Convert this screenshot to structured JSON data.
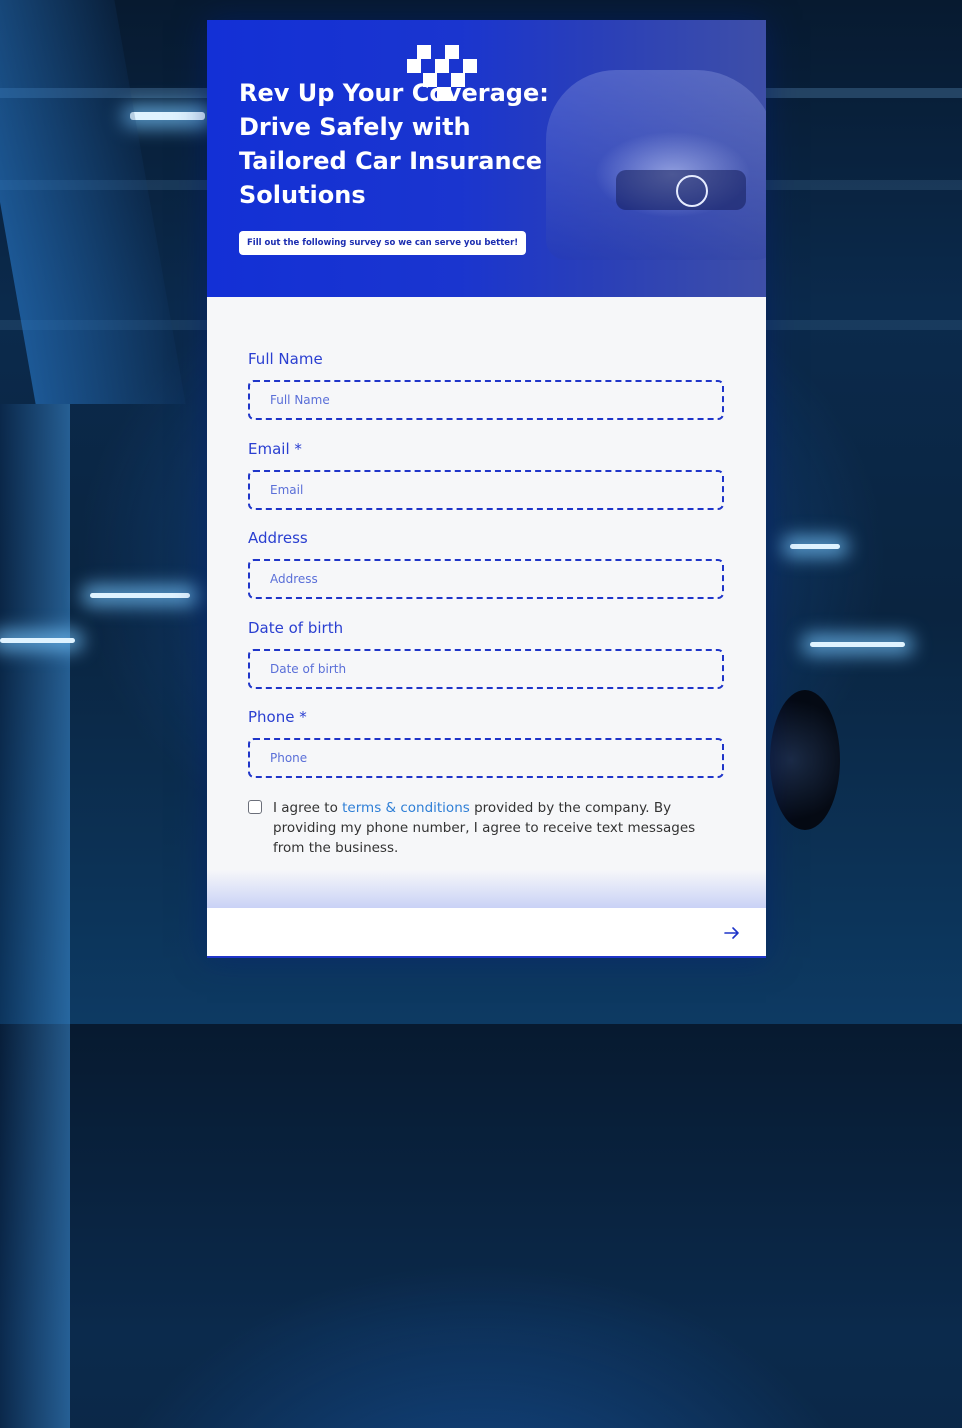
{
  "hero": {
    "title": "Rev Up Your Coverage: Drive Safely with Tailored Car Insurance Solutions",
    "subtitle": "Fill out the following survey so we can serve you better!"
  },
  "form": {
    "fields": [
      {
        "label": "Full Name",
        "placeholder": "Full Name"
      },
      {
        "label": "Email *",
        "placeholder": "Email"
      },
      {
        "label": "Address",
        "placeholder": "Address"
      },
      {
        "label": "Date of birth",
        "placeholder": "Date of birth"
      },
      {
        "label": "Phone *",
        "placeholder": "Phone"
      }
    ],
    "consent": {
      "prefix": "I agree to ",
      "link": "terms & conditions",
      "suffix": " provided by the company. By providing my phone number, I agree to receive text messages from the business.",
      "checked": false
    }
  },
  "footer": {
    "next_icon": "arrow-right-icon"
  },
  "colors": {
    "accent": "#1f35c9",
    "hero_bg": "#1330d6",
    "link": "#2f7fd6"
  }
}
